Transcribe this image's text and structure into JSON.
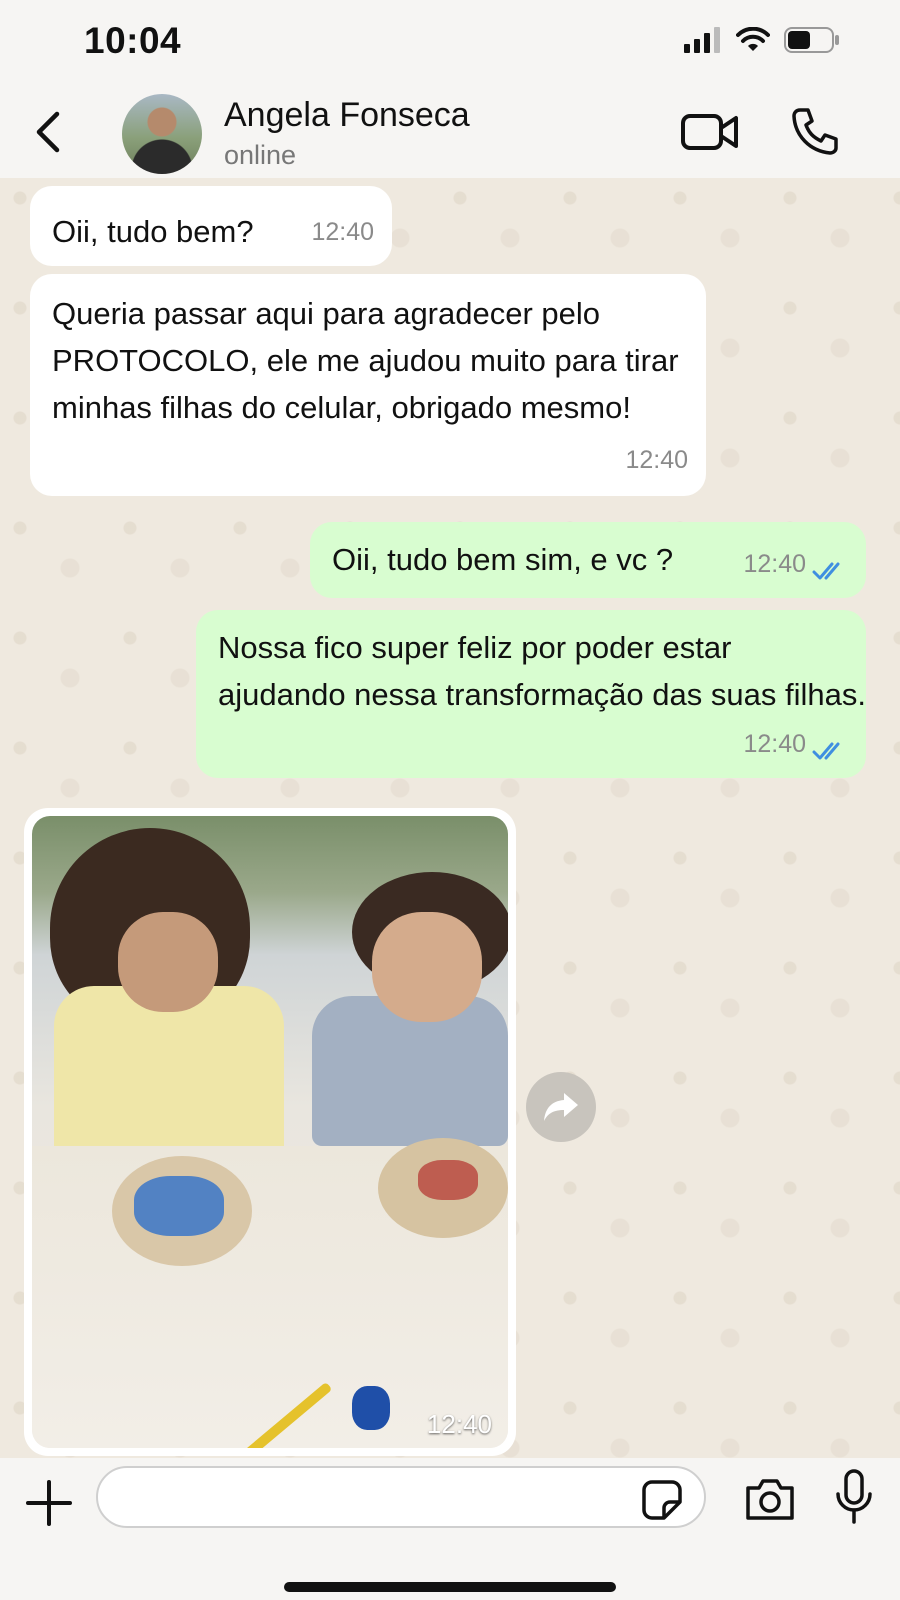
{
  "status_bar": {
    "time": "10:04",
    "icons": [
      "signal-icon",
      "wifi-icon",
      "battery-icon"
    ]
  },
  "header": {
    "contact_name": "Angela Fonseca",
    "contact_status": "online",
    "icons": [
      "back-chevron-icon",
      "video-camera-icon",
      "phone-icon"
    ]
  },
  "messages": [
    {
      "direction": "incoming",
      "text": "Oii, tudo bem?",
      "time": "12:40"
    },
    {
      "direction": "incoming",
      "text": "Queria passar aqui para agradecer pelo PROTOCOLO, ele me ajudou muito para tirar minhas filhas do celular, obrigado mesmo!",
      "time": "12:40"
    },
    {
      "direction": "outgoing",
      "text": "Oii, tudo bem sim, e vc ?",
      "time": "12:40",
      "status": "read"
    },
    {
      "direction": "outgoing",
      "text": "Nossa fico super feliz por poder estar ajudando nessa transformação das suas filhas.",
      "time": "12:40",
      "status": "read"
    },
    {
      "direction": "incoming",
      "type": "photo",
      "time": "12:40"
    }
  ],
  "input": {
    "placeholder": "",
    "value": ""
  },
  "colors": {
    "outgoing_bubble": "#d8fdd0",
    "incoming_bubble": "#ffffff",
    "read_ticks": "#3f8fe0",
    "chat_background": "#efe9df"
  }
}
